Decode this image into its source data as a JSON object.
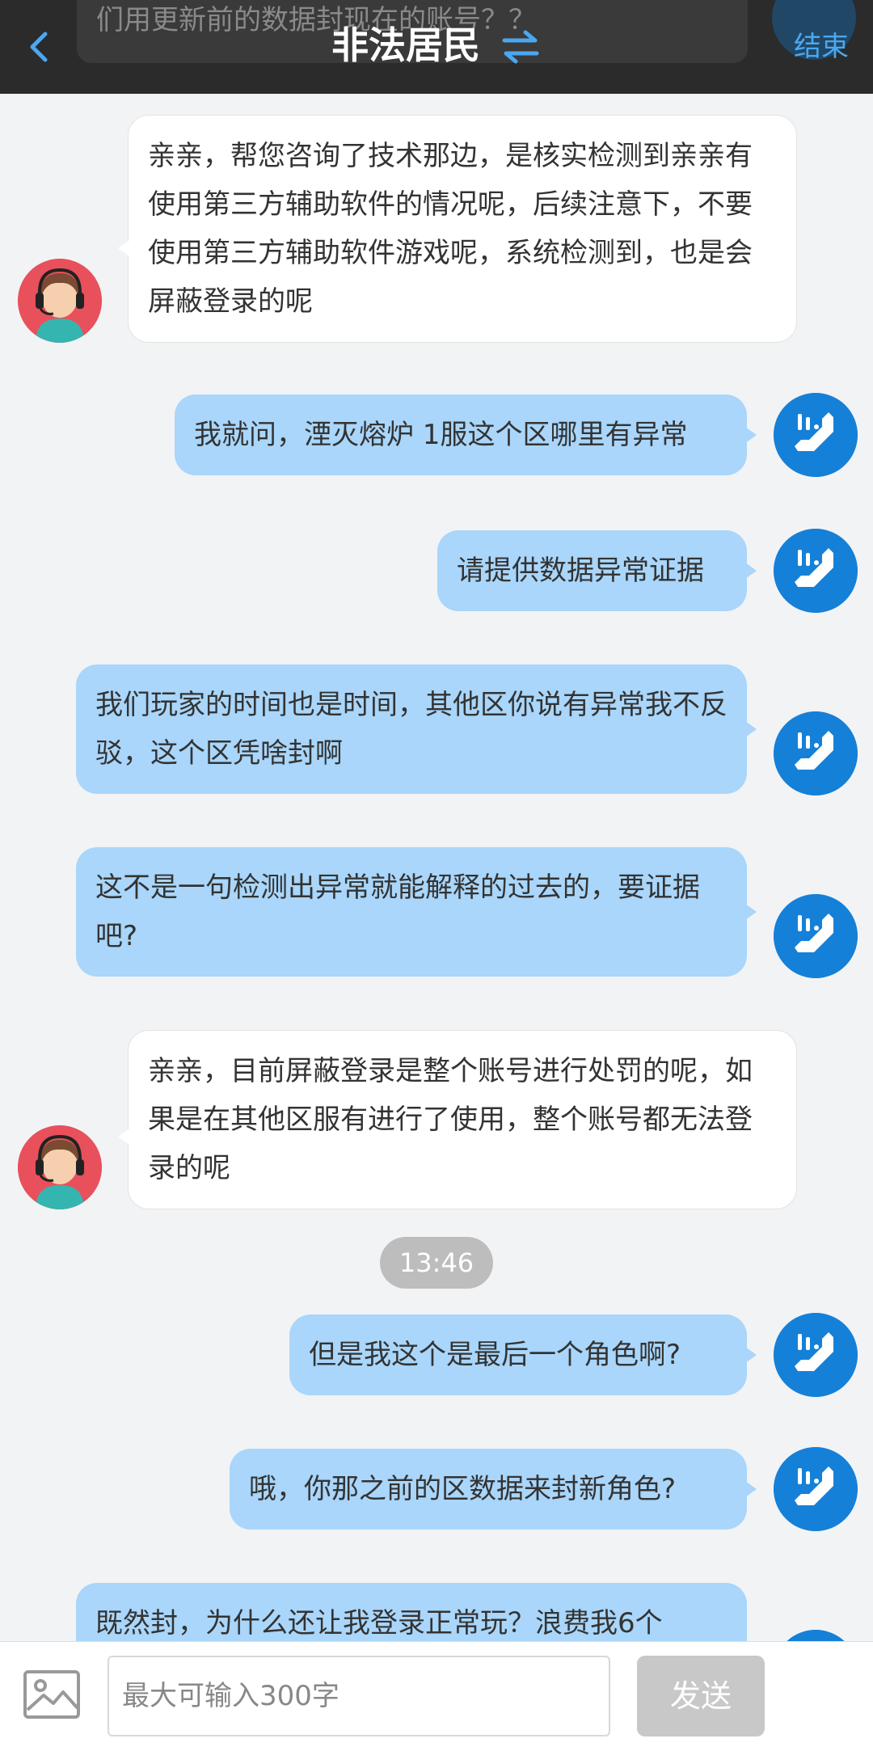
{
  "header": {
    "title": "非法居民",
    "end_label": "结束",
    "ghost_text": "们用更新前的数据封现在的账号？？"
  },
  "messages": [
    {
      "from": "agent",
      "text": "亲亲，帮您咨询了技术那边，是核实检测到亲亲有使用第三方辅助软件的情况呢，后续注意下，不要使用第三方辅助软件游戏呢，系统检测到，也是会屏蔽登录的呢"
    },
    {
      "from": "user",
      "text": "我就问，湮灭熔炉 1服这个区哪里有异常"
    },
    {
      "from": "user",
      "text": "请提供数据异常证据"
    },
    {
      "from": "user",
      "text": "我们玩家的时间也是时间，其他区你说有异常我不反驳，这个区凭啥封啊"
    },
    {
      "from": "user",
      "text": "这不是一句检测出异常就能解释的过去的，要证据吧?"
    },
    {
      "from": "agent",
      "text": "亲亲，目前屏蔽登录是整个账号进行处罚的呢，如果是在其他区服有进行了使用，整个账号都无法登录的呢"
    },
    {
      "from": "user",
      "text": "但是我这个是最后一个角色啊?"
    },
    {
      "from": "user",
      "text": "哦，你那之前的区数据来封新角色?"
    },
    {
      "from": "user",
      "text": "既然封，为什么还让我登录正常玩？浪费我6个"
    }
  ],
  "timestamp": "13:46",
  "composer": {
    "placeholder": "最大可输入300字",
    "send_label": "发送"
  },
  "colors": {
    "user_bubble": "#a9d6fa",
    "agent_bubble": "#ffffff",
    "header": "#2b2b2b",
    "accent": "#4aa8f0"
  },
  "icons": [
    "back-arrow-icon",
    "swap-arrows-icon",
    "phone-avatar-icon",
    "support-agent-avatar-icon",
    "image-icon"
  ]
}
